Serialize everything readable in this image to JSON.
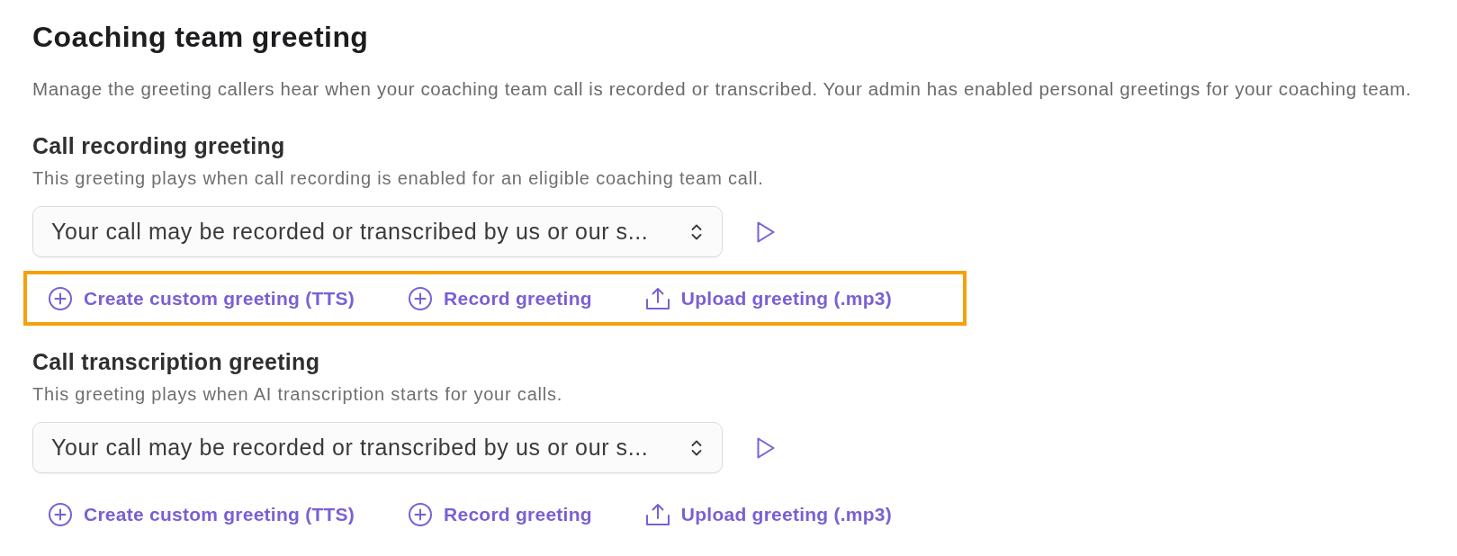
{
  "title": "Coaching team greeting",
  "description": "Manage the greeting callers hear when your coaching team call is recorded or transcribed. Your admin has enabled personal greetings for your coaching team.",
  "sections": [
    {
      "heading": "Call recording greeting",
      "description": "This greeting plays when call recording is enabled for an eligible coaching team call.",
      "select": {
        "value": "Your call may be recorded or transcribed by us or our s..."
      },
      "highlighted": true,
      "actions": [
        {
          "kind": "add",
          "label": "Create custom greeting (TTS)"
        },
        {
          "kind": "add",
          "label": "Record greeting"
        },
        {
          "kind": "upload",
          "label": "Upload greeting (.mp3)"
        }
      ]
    },
    {
      "heading": "Call transcription greeting",
      "description": "This greeting plays when AI transcription starts for your calls.",
      "select": {
        "value": "Your call may be recorded or transcribed by us or our s..."
      },
      "highlighted": false,
      "actions": [
        {
          "kind": "add",
          "label": "Create custom greeting (TTS)"
        },
        {
          "kind": "add",
          "label": "Record greeting"
        },
        {
          "kind": "upload",
          "label": "Upload greeting (.mp3)"
        }
      ]
    }
  ]
}
